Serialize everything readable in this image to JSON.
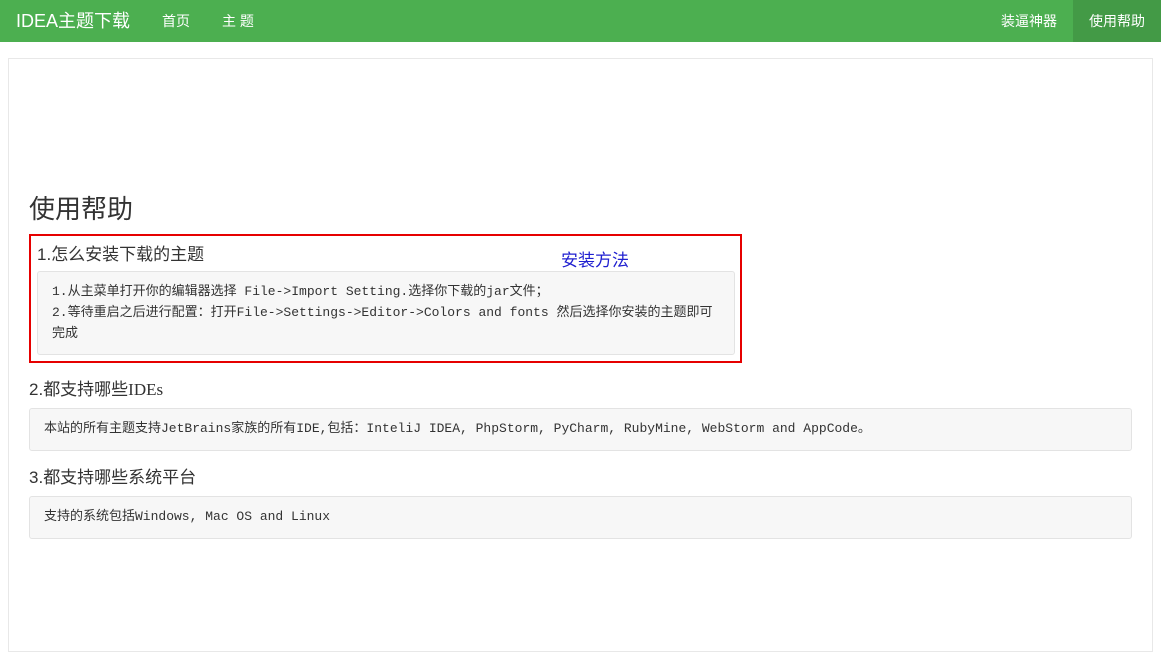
{
  "nav": {
    "brand": "IDEA主题下载",
    "left": [
      {
        "label": "首页"
      },
      {
        "label": "主 题"
      }
    ],
    "right": [
      {
        "label": "装逼神器",
        "active": false
      },
      {
        "label": "使用帮助",
        "active": true
      }
    ]
  },
  "page": {
    "title": "使用帮助",
    "install_label": "安装方法",
    "sections": [
      {
        "num": "1.",
        "heading": "怎么安装下载的主题",
        "lines": [
          "1.从主菜单打开你的编辑器选择 File->Import Setting.选择你下载的jar文件；",
          "2.等待重启之后进行配置：打开File->Settings->Editor->Colors and fonts 然后选择你安装的主题即可完成"
        ]
      },
      {
        "num": "2.",
        "heading": "都支持哪些IDEs",
        "lines": [
          "本站的所有主题支持JetBrains家族的所有IDE,包括：InteliJ IDEA, PhpStorm, PyCharm, RubyMine, WebStorm and AppCode。"
        ]
      },
      {
        "num": "3.",
        "heading": "都支持哪些系统平台",
        "lines": [
          "支持的系统包括Windows, Mac OS and Linux"
        ]
      }
    ]
  }
}
